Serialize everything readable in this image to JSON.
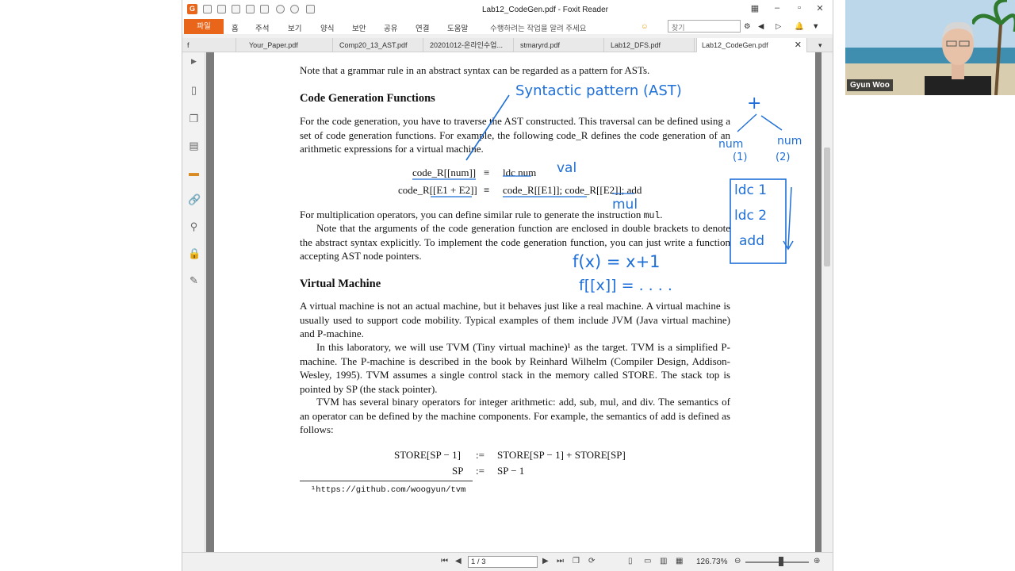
{
  "app": {
    "window_title": "Lab12_CodeGen.pdf - Foxit Reader",
    "menus": [
      "파일",
      "홈",
      "주석",
      "보기",
      "양식",
      "보안",
      "공유",
      "연결",
      "도움말"
    ],
    "tell_me": "수행하려는 작업을 알려 주세요",
    "search_placeholder": "찾기"
  },
  "tabs": [
    "f",
    "Your_Paper.pdf",
    "Comp20_13_AST.pdf",
    "20201012-온라인수업...",
    "stmaryrd.pdf",
    "Lab12_DFS.pdf",
    "Lab12_CodeGen.pdf"
  ],
  "status": {
    "page": "1 / 3",
    "zoom": "126.73%"
  },
  "video": {
    "name": "Gyun Woo"
  },
  "doc": {
    "p_intro": "Note that a grammar rule in an abstract syntax can be regarded as a pattern for ASTs.",
    "h_codegen": "Code Generation Functions",
    "p_codegen": "For the code generation, you have to traverse the AST constructed. This traversal can be defined using a set of code generation functions. For example, the following code_R defines the code generation of an arithmetic expressions for a virtual machine.",
    "eq1_lhs": "code_R[[num]]",
    "eq1_rhs": "ldc num",
    "eq2_lhs": "code_R[[E1 + E2]]",
    "eq2_rhs": "code_R[[E1]]; code_R[[E2]]; add",
    "equiv": "≡",
    "p_mult_a": "For multiplication operators, you can define similar rule to generate the instruction ",
    "p_mult_code": "mul",
    "p_mult_b": ".",
    "p_note": "Note that the arguments of the code generation function are enclosed in double brackets to denote the abstract syntax explicitly. To implement the code generation function, you can just write a function accepting AST node pointers.",
    "h_vm": "Virtual Machine",
    "p_vm1": "A virtual machine is not an actual machine, but it behaves just like a real machine. A virtual machine is usually used to support code mobility. Typical examples of them include JVM (Java virtual machine) and P-machine.",
    "p_vm2": "In this laboratory, we will use TVM (Tiny virtual machine)¹ as the target. TVM is a simplified P-machine. The P-machine is described in the book by Reinhard Wilhelm (Compiler Design, Addison-Wesley, 1995). TVM assumes a single control stack in the memory called STORE. The stack top is pointed by SP (the stack pointer).",
    "p_vm3": "TVM has several binary operators for integer arithmetic: add, sub, mul, and div. The semantics of an operator can be defined by the machine components. For example, the semantics of add is defined as follows:",
    "sem1_lhs": "STORE[SP − 1]",
    "sem1_rhs": "STORE[SP − 1] + STORE[SP]",
    "sem2_lhs": "SP",
    "sem2_rhs": "SP − 1",
    "assign": ":=",
    "footnote": "¹https://github.com/woogyun/tvm"
  },
  "annotations": {
    "syntactic": "Syntactic pattern (AST)",
    "val": "val",
    "mul": "mul",
    "plus": "+",
    "num1": "num",
    "num1b": "(1)",
    "num2": "num",
    "num2b": "(2)",
    "box1": "ldc 1",
    "box2": "ldc 2",
    "box3": "add",
    "fx": "f(x) = x+1",
    "fbr": "f[[x]] = . . . ."
  }
}
